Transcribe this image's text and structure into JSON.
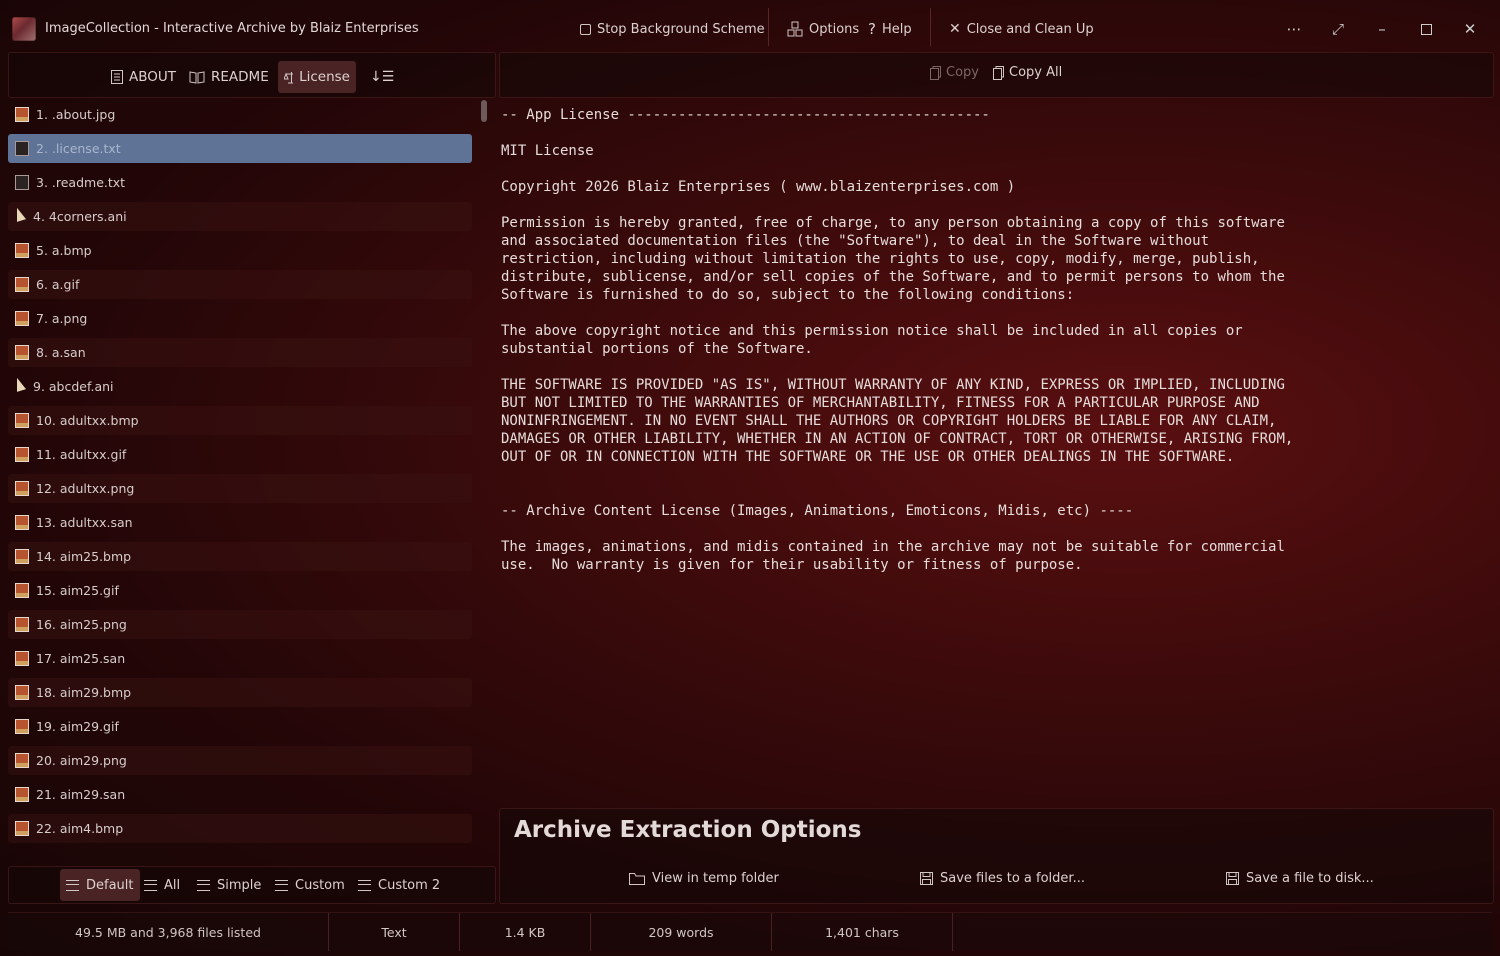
{
  "title_bar": {
    "app_title": "ImageCollection  -  Interactive Archive by Blaiz Enterprises",
    "stop_bg": "Stop Background Scheme",
    "options": "Options",
    "help": "Help",
    "close_clean": "Close and Clean Up"
  },
  "left_toolbar": {
    "about": "ABOUT",
    "readme": "README",
    "license": "License"
  },
  "right_toolbar": {
    "copy": "Copy",
    "copy_all": "Copy All"
  },
  "files": [
    {
      "label": "1.  .about.jpg",
      "icon": "image-file-icon"
    },
    {
      "label": "2.  .license.txt",
      "icon": "text-file-icon"
    },
    {
      "label": "3.  .readme.txt",
      "icon": "text-file-icon"
    },
    {
      "label": "4.  4corners.ani",
      "icon": "cursor-file-icon"
    },
    {
      "label": "5.  a.bmp",
      "icon": "image-file-icon"
    },
    {
      "label": "6.  a.gif",
      "icon": "image-file-icon"
    },
    {
      "label": "7.  a.png",
      "icon": "image-file-icon"
    },
    {
      "label": "8.  a.san",
      "icon": "image-file-icon"
    },
    {
      "label": "9.  abcdef.ani",
      "icon": "cursor-file-icon"
    },
    {
      "label": "10.  adultxx.bmp",
      "icon": "image-file-icon"
    },
    {
      "label": "11.  adultxx.gif",
      "icon": "image-file-icon"
    },
    {
      "label": "12.  adultxx.png",
      "icon": "image-file-icon"
    },
    {
      "label": "13.  adultxx.san",
      "icon": "image-file-icon"
    },
    {
      "label": "14.  aim25.bmp",
      "icon": "image-file-icon"
    },
    {
      "label": "15.  aim25.gif",
      "icon": "image-file-icon"
    },
    {
      "label": "16.  aim25.png",
      "icon": "image-file-icon"
    },
    {
      "label": "17.  aim25.san",
      "icon": "image-file-icon"
    },
    {
      "label": "18.  aim29.bmp",
      "icon": "image-file-icon"
    },
    {
      "label": "19.  aim29.gif",
      "icon": "image-file-icon"
    },
    {
      "label": "20.  aim29.png",
      "icon": "image-file-icon"
    },
    {
      "label": "21.  aim29.san",
      "icon": "image-file-icon"
    },
    {
      "label": "22.  aim4.bmp",
      "icon": "image-file-icon"
    }
  ],
  "selected_file_index": 1,
  "view_modes": {
    "default": "Default",
    "all": "All",
    "simple": "Simple",
    "custom": "Custom",
    "custom2": "Custom 2"
  },
  "license_text": "-- App License -------------------------------------------\n\nMIT License\n\nCopyright 2026 Blaiz Enterprises ( www.blaizenterprises.com )\n\nPermission is hereby granted, free of charge, to any person obtaining a copy of this software\nand associated documentation files (the \"Software\"), to deal in the Software without\nrestriction, including without limitation the rights to use, copy, modify, merge, publish,\ndistribute, sublicense, and/or sell copies of the Software, and to permit persons to whom the\nSoftware is furnished to do so, subject to the following conditions:\n\nThe above copyright notice and this permission notice shall be included in all copies or\nsubstantial portions of the Software.\n\nTHE SOFTWARE IS PROVIDED \"AS IS\", WITHOUT WARRANTY OF ANY KIND, EXPRESS OR IMPLIED, INCLUDING\nBUT NOT LIMITED TO THE WARRANTIES OF MERCHANTABILITY, FITNESS FOR A PARTICULAR PURPOSE AND\nNONINFRINGEMENT. IN NO EVENT SHALL THE AUTHORS OR COPYRIGHT HOLDERS BE LIABLE FOR ANY CLAIM,\nDAMAGES OR OTHER LIABILITY, WHETHER IN AN ACTION OF CONTRACT, TORT OR OTHERWISE, ARISING FROM,\nOUT OF OR IN CONNECTION WITH THE SOFTWARE OR THE USE OR OTHER DEALINGS IN THE SOFTWARE.\n\n\n-- Archive Content License (Images, Animations, Emoticons, Midis, etc) ----\n\nThe images, animations, and midis contained in the archive may not be suitable for commercial\nuse.  No warranty is given for their usability or fitness of purpose.",
  "extraction": {
    "title": "Archive Extraction Options",
    "view_temp": "View in temp folder",
    "save_folder": "Save files to a folder...",
    "save_disk": "Save a file to disk..."
  },
  "status": {
    "summary": "49.5 MB and 3,968 files listed",
    "type": "Text",
    "size": "1.4 KB",
    "words": "209 words",
    "chars": "1,401 chars"
  },
  "colors": {
    "selected_row": "#5e7396",
    "active_tab": "#4a2324",
    "background": "#3c0a0b"
  }
}
